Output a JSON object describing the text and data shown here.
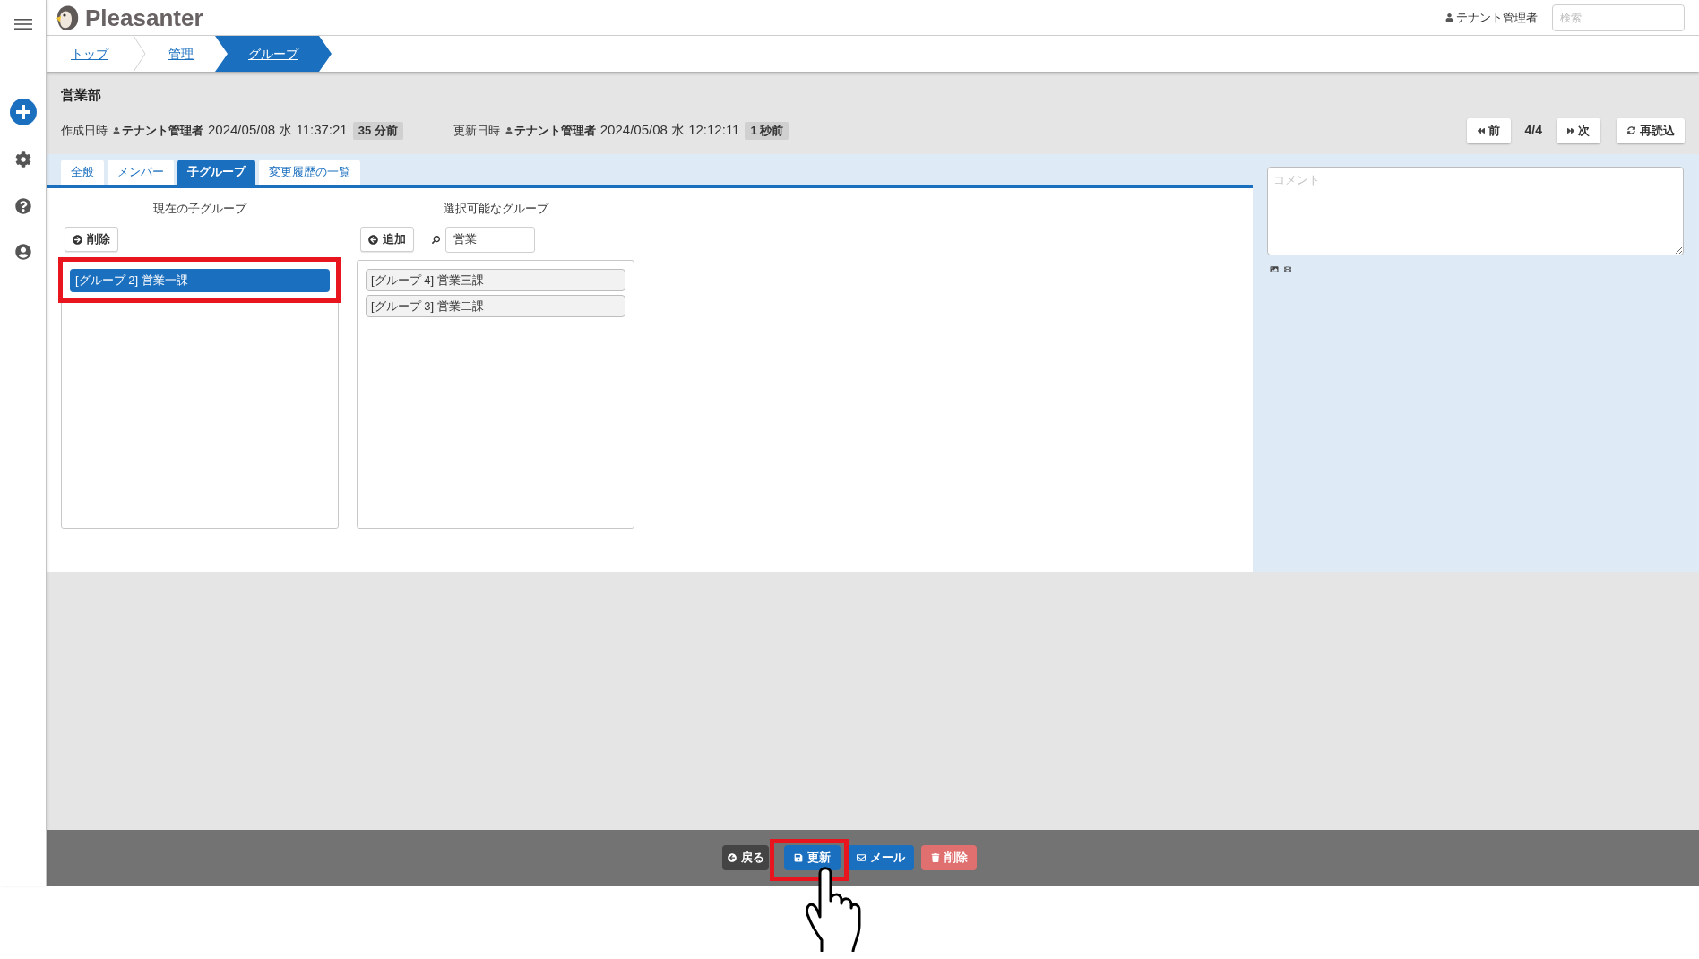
{
  "header": {
    "logo": "Pleasanter",
    "user": "テナント管理者",
    "search": {
      "placeholder": "検索"
    }
  },
  "breadcrumb": [
    {
      "label": "トップ",
      "selected": false
    },
    {
      "label": "管理",
      "selected": false
    },
    {
      "label": "グループ",
      "selected": true
    }
  ],
  "record": {
    "title": "営業部",
    "meta": [
      {
        "label": "作成日時",
        "user": "テナント管理者",
        "datetime": "2024/05/08 水 11:37:21",
        "ago": "35 分前"
      },
      {
        "label": "更新日時",
        "user": "テナント管理者",
        "datetime": "2024/05/08 水 12:12:11",
        "ago": "1 秒前"
      }
    ]
  },
  "pager": {
    "previous": "前",
    "position": "4/4",
    "next": "次",
    "reload": "再読込"
  },
  "tabs": [
    {
      "label": "全般",
      "selected": false
    },
    {
      "label": "メンバー",
      "selected": false
    },
    {
      "label": "子グループ",
      "selected": true
    },
    {
      "label": "変更履歴の一覧",
      "selected": false
    }
  ],
  "current_children": {
    "heading": "現在の子グループ",
    "button": "削除",
    "items": [
      {
        "label": "[グループ 2] 営業一課",
        "selected": true,
        "highlighted": true
      }
    ]
  },
  "selectable_groups": {
    "heading": "選択可能なグループ",
    "button": "追加",
    "search": {
      "value": "営業"
    },
    "items": [
      {
        "label": "[グループ 4] 営業三課",
        "selected": false,
        "highlighted": false
      },
      {
        "label": "[グループ 3] 営業二課",
        "selected": false,
        "highlighted": false
      }
    ]
  },
  "comment": {
    "placeholder": "コメント"
  },
  "footer_buttons": [
    {
      "kind": "back",
      "label": "戻る",
      "highlighted": false,
      "pointer": false
    },
    {
      "kind": "update",
      "label": "更新",
      "highlighted": true,
      "pointer": true
    },
    {
      "kind": "mail",
      "label": "メール",
      "highlighted": false,
      "pointer": false
    },
    {
      "kind": "delete",
      "label": "削除",
      "highlighted": false,
      "pointer": false
    }
  ]
}
